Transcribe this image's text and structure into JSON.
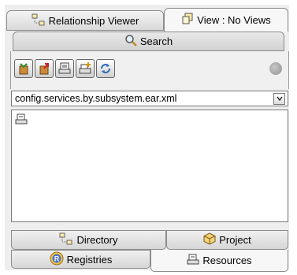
{
  "tabs": {
    "relationship_viewer": "Relationship Viewer",
    "view": "View : No Views",
    "search": "Search"
  },
  "toolbar": {
    "buttons": [
      "import-icon",
      "export-icon",
      "resource-icon",
      "add-resource-icon",
      "refresh-icon"
    ],
    "stop": "stop-icon"
  },
  "combo": {
    "value": "config.services.by.subsystem.ear.xml"
  },
  "list": {
    "items": [
      "resource-icon"
    ]
  },
  "bottom_tabs": {
    "directory": "Directory",
    "project": "Project",
    "registries": "Registries",
    "resources": "Resources"
  },
  "colors": {
    "panel": "#eeeeee",
    "border": "#8c8c8c",
    "accent_blue": "#3b6fb6"
  }
}
